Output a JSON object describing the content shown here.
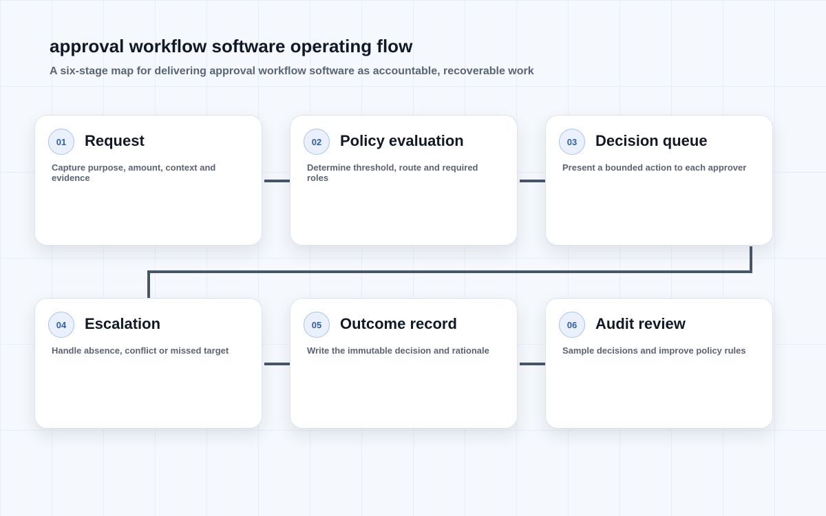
{
  "header": {
    "title": "approval workflow software operating flow",
    "subtitle": "A six-stage map for delivering approval workflow software as accountable, recoverable work"
  },
  "stages": [
    {
      "number": "01",
      "title": "Request",
      "description": "Capture purpose, amount, context and evidence"
    },
    {
      "number": "02",
      "title": "Policy evaluation",
      "description": "Determine threshold, route and required roles"
    },
    {
      "number": "03",
      "title": "Decision queue",
      "description": "Present a bounded action to each approver"
    },
    {
      "number": "04",
      "title": "Escalation",
      "description": "Handle absence, conflict or missed target"
    },
    {
      "number": "05",
      "title": "Outcome record",
      "description": "Write the immutable decision and rationale"
    },
    {
      "number": "06",
      "title": "Audit review",
      "description": "Sample decisions and improve policy rules"
    }
  ],
  "colors": {
    "connector": "#475569",
    "card_background": "#ffffff",
    "badge_background": "#eaf1fd",
    "badge_text": "#2f5fa8",
    "page_background": "#f5f8fc"
  }
}
